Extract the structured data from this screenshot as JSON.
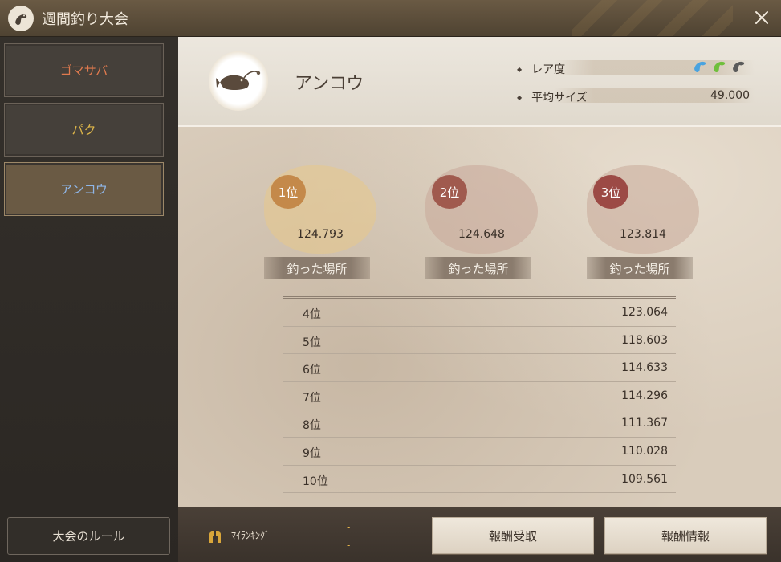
{
  "window": {
    "title": "週間釣り大会",
    "icon": "fish-logo-icon",
    "close_icon": "close-icon"
  },
  "sidebar": {
    "items": [
      {
        "label": "ゴマサバ",
        "color": "#e07a4e",
        "active": false
      },
      {
        "label": "パク",
        "color": "#e0b84a",
        "active": false
      },
      {
        "label": "アンコウ",
        "color": "#8fb6e8",
        "active": true
      }
    ],
    "rules_button": "大会のルール"
  },
  "fish": {
    "name": "アンコウ",
    "rarity_label": "レア度",
    "rarity_icons": [
      {
        "icon": "fish-icon",
        "color": "#4aa3df"
      },
      {
        "icon": "fish-icon",
        "color": "#6fbf3c"
      },
      {
        "icon": "fish-icon",
        "color": "#5a5a5a"
      }
    ],
    "avg_size_label": "平均サイズ",
    "avg_size_value": "49.000"
  },
  "podium": [
    {
      "rank": "1位",
      "value": "124.793",
      "button": "釣った場所",
      "badge_color": "#c4894a",
      "splash_color": "#e8c98a"
    },
    {
      "rank": "2位",
      "value": "124.648",
      "button": "釣った場所",
      "badge_color": "#a05a4e",
      "splash_color": "#c9a899"
    },
    {
      "rank": "3位",
      "value": "123.814",
      "button": "釣った場所",
      "badge_color": "#9c4a45",
      "splash_color": "#c9aa99"
    }
  ],
  "rankings": [
    {
      "rank": "4位",
      "value": "123.064"
    },
    {
      "rank": "5位",
      "value": "118.603"
    },
    {
      "rank": "6位",
      "value": "114.633"
    },
    {
      "rank": "7位",
      "value": "114.296"
    },
    {
      "rank": "8位",
      "value": "111.367"
    },
    {
      "rank": "9位",
      "value": "110.028"
    },
    {
      "rank": "10位",
      "value": "109.561"
    }
  ],
  "bottom": {
    "my_ranking_label": "ﾏｲﾗﾝｷﾝｸﾞ",
    "my_ranking_rank": "-",
    "my_ranking_value": "-",
    "reward_receive": "報酬受取",
    "reward_info": "報酬情報"
  }
}
